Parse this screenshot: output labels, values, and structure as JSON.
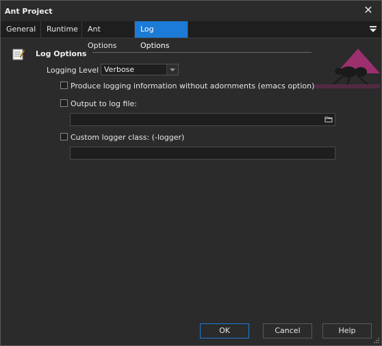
{
  "window": {
    "title": "Ant Project"
  },
  "tabs": [
    "General",
    "Runtime",
    "Ant Options",
    "Log Options"
  ],
  "active_tab": "Log Options",
  "section": {
    "title": "Log Options"
  },
  "logging_level": {
    "label": "Logging Level :",
    "value": "Verbose"
  },
  "options": {
    "emacs": {
      "label": "Produce logging information without adornments (emacs option)",
      "checked": false
    },
    "log_file": {
      "label": "Output to log file:",
      "checked": false,
      "value": ""
    },
    "custom_logger": {
      "label": "Custom logger class: (-logger)",
      "checked": false,
      "value": ""
    }
  },
  "buttons": {
    "ok": "OK",
    "cancel": "Cancel",
    "help": "Help"
  },
  "colors": {
    "accent": "#1c7bd6",
    "background": "#2b2b2b",
    "logo": "#b0307a"
  },
  "icons": {
    "close": "close-icon",
    "tab_menu": "menu-icon",
    "section": "notepad-icon",
    "browse": "folder-icon",
    "logo": "ant-logo"
  }
}
